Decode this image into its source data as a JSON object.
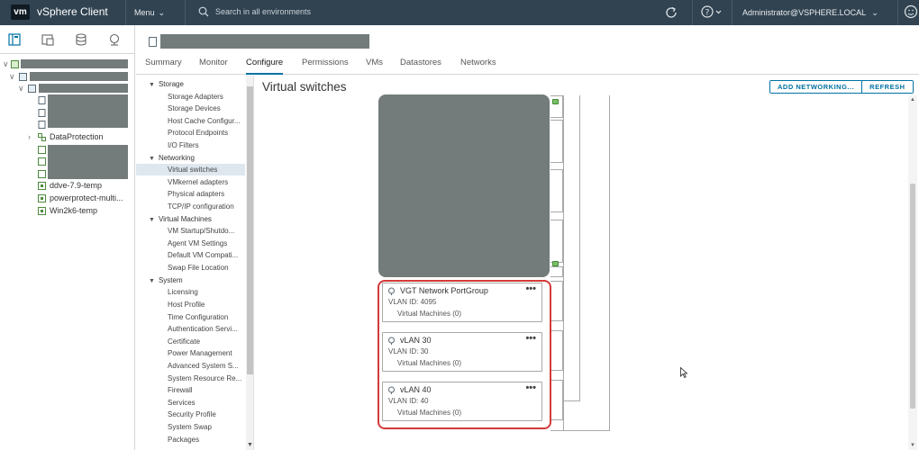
{
  "topbar": {
    "logo": "vm",
    "app_title": "vSphere Client",
    "menu_label": "Menu",
    "search_placeholder": "Search in all environments",
    "user_label": "Administrator@VSPHERE.LOCAL"
  },
  "inventory": {
    "tabs": [
      "hosts-and-clusters",
      "vms-and-templates",
      "storage",
      "networking"
    ],
    "items": [
      {
        "label": "DataProtection",
        "type": "folder"
      },
      {
        "label": "ddve-7.9-temp",
        "type": "vm-template"
      },
      {
        "label": "powerprotect-multi...",
        "type": "vm-template"
      },
      {
        "label": "Win2k6-temp",
        "type": "vm-template"
      }
    ]
  },
  "object_tabs": [
    {
      "label": "Summary",
      "active": false
    },
    {
      "label": "Monitor",
      "active": false
    },
    {
      "label": "Configure",
      "active": true
    },
    {
      "label": "Permissions",
      "active": false
    },
    {
      "label": "VMs",
      "active": false
    },
    {
      "label": "Datastores",
      "active": false
    },
    {
      "label": "Networks",
      "active": false
    }
  ],
  "config_nav": [
    {
      "label": "Storage",
      "group": true
    },
    {
      "label": "Storage Adapters"
    },
    {
      "label": "Storage Devices"
    },
    {
      "label": "Host Cache Configur..."
    },
    {
      "label": "Protocol Endpoints"
    },
    {
      "label": "I/O Filters"
    },
    {
      "label": "Networking",
      "group": true
    },
    {
      "label": "Virtual switches",
      "selected": true
    },
    {
      "label": "VMkernel adapters"
    },
    {
      "label": "Physical adapters"
    },
    {
      "label": "TCP/IP configuration"
    },
    {
      "label": "Virtual Machines",
      "group": true
    },
    {
      "label": "VM Startup/Shutdo..."
    },
    {
      "label": "Agent VM Settings"
    },
    {
      "label": "Default VM Compati..."
    },
    {
      "label": "Swap File Location"
    },
    {
      "label": "System",
      "group": true
    },
    {
      "label": "Licensing"
    },
    {
      "label": "Host Profile"
    },
    {
      "label": "Time Configuration"
    },
    {
      "label": "Authentication Servi..."
    },
    {
      "label": "Certificate"
    },
    {
      "label": "Power Management"
    },
    {
      "label": "Advanced System S..."
    },
    {
      "label": "System Resource Re..."
    },
    {
      "label": "Firewall"
    },
    {
      "label": "Services"
    },
    {
      "label": "Security Profile"
    },
    {
      "label": "System Swap"
    },
    {
      "label": "Packages"
    }
  ],
  "content": {
    "title": "Virtual switches",
    "add_networking_label": "ADD NETWORKING...",
    "refresh_label": "REFRESH",
    "port_groups": [
      {
        "name": "VGT Network PortGroup",
        "vlan": "VLAN ID: 4095",
        "vms": "Virtual Machines (0)"
      },
      {
        "name": "vLAN 30",
        "vlan": "VLAN ID: 30",
        "vms": "Virtual Machines (0)"
      },
      {
        "name": "vLAN 40",
        "vlan": "VLAN ID: 40",
        "vms": "Virtual Machines (0)"
      }
    ],
    "more_actions_glyph": "•••"
  }
}
